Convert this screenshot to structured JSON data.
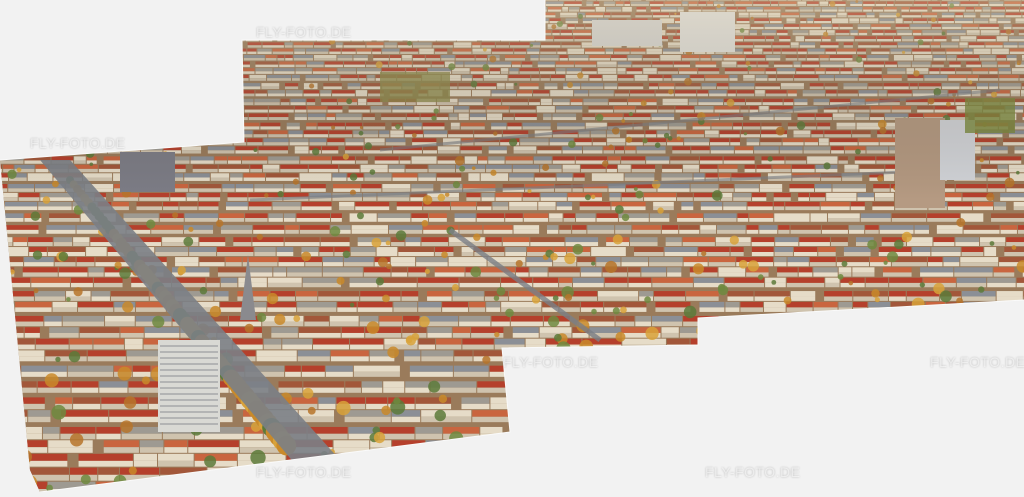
{
  "watermark": "FLY-FOTO.DE",
  "colors": {
    "background": "#f2f2f2",
    "roof_red": "#b5402c",
    "roof_terracotta": "#c9653f",
    "roof_grey": "#8b8f96",
    "facade_cream": "#e6dcc8",
    "tree_autumn": "#c98a2a",
    "tree_green": "#5c7a3a",
    "street": "#7b7f86"
  }
}
